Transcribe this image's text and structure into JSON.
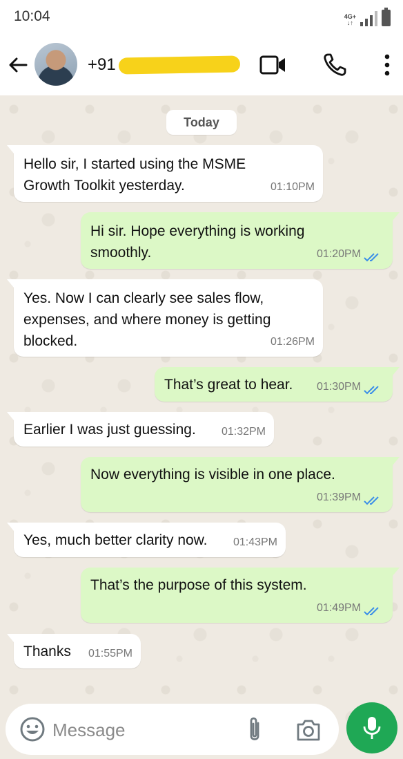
{
  "status_bar": {
    "time": "10:04",
    "network": "4G+"
  },
  "header": {
    "contact_name": "+91",
    "contact_redacted": true
  },
  "conversation": {
    "date_label": "Today",
    "messages": [
      {
        "direction": "incoming",
        "lines": [
          "Hello sir, I started using the MSME",
          "Growth Toolkit yesterday."
        ],
        "time": "01:10PM"
      },
      {
        "direction": "outgoing",
        "lines": [
          "Hi sir. Hope everything is working",
          "smoothly."
        ],
        "time": "01:20PM",
        "status": "read"
      },
      {
        "direction": "incoming",
        "lines": [
          "Yes. Now I can clearly see sales flow,",
          "expenses, and where money is getting",
          "blocked."
        ],
        "time": "01:26PM"
      },
      {
        "direction": "outgoing",
        "lines": [
          "That’s great to hear."
        ],
        "time": "01:30PM",
        "status": "read"
      },
      {
        "direction": "incoming",
        "lines": [
          "Earlier I was just guessing."
        ],
        "time": "01:32PM"
      },
      {
        "direction": "outgoing",
        "lines": [
          "Now everything is visible in one place."
        ],
        "time": "01:39PM",
        "status": "read"
      },
      {
        "direction": "incoming",
        "lines": [
          "Yes, much better clarity now."
        ],
        "time": "01:43PM"
      },
      {
        "direction": "outgoing",
        "lines": [
          "That’s the purpose of this system."
        ],
        "time": "01:49PM",
        "status": "read"
      },
      {
        "direction": "incoming",
        "lines": [
          "Thanks"
        ],
        "time": "01:55PM"
      }
    ]
  },
  "composer": {
    "placeholder": "Message",
    "value": ""
  },
  "colors": {
    "incoming_bubble": "#ffffff",
    "outgoing_bubble": "#dcf8c6",
    "read_ticks": "#3b8ee8",
    "mic_button": "#1fa855",
    "wallpaper": "#efeae2"
  },
  "icons": [
    "back-arrow-icon",
    "video-call-icon",
    "phone-icon",
    "more-vert-icon",
    "emoji-icon",
    "attach-icon",
    "camera-icon",
    "mic-icon",
    "double-check-icon"
  ]
}
